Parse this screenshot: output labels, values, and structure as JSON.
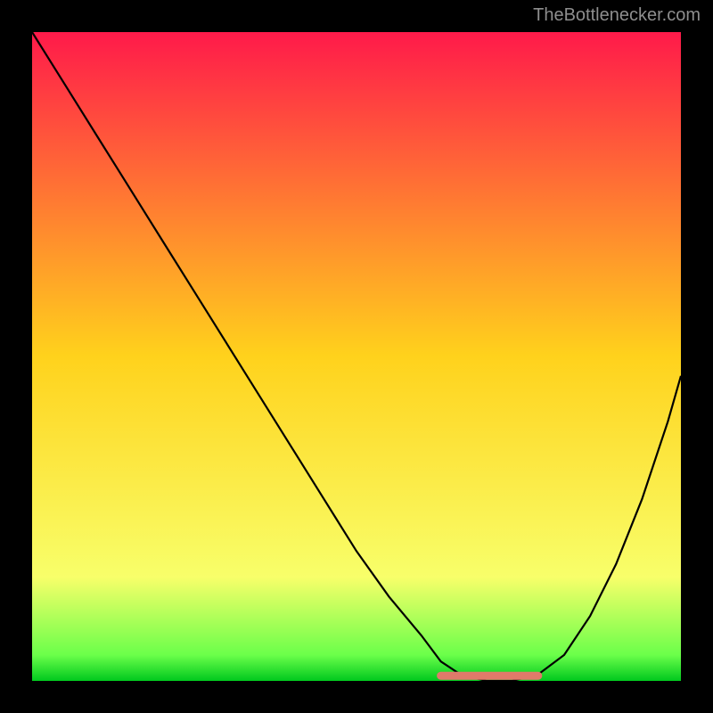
{
  "watermark": "TheBottlenecker.com",
  "chart_data": {
    "type": "line",
    "title": "",
    "xlabel": "",
    "ylabel": "",
    "xlim": [
      0,
      100
    ],
    "ylim": [
      0,
      100
    ],
    "background": "heatmap-gradient",
    "gradient_stops": [
      {
        "offset": 0,
        "color": "#ff1a4a"
      },
      {
        "offset": 50,
        "color": "#ffd21c"
      },
      {
        "offset": 84,
        "color": "#f8ff6a"
      },
      {
        "offset": 96,
        "color": "#6bff4a"
      },
      {
        "offset": 100,
        "color": "#00c81e"
      }
    ],
    "series": [
      {
        "name": "bottleneck-curve",
        "color": "#000000",
        "x": [
          0,
          5,
          10,
          15,
          20,
          25,
          30,
          35,
          40,
          45,
          50,
          55,
          60,
          63,
          66,
          70,
          74,
          78,
          82,
          86,
          90,
          94,
          98,
          100
        ],
        "y": [
          100,
          92,
          84,
          76,
          68,
          60,
          52,
          44,
          36,
          28,
          20,
          13,
          7,
          3,
          1,
          0,
          0,
          1,
          4,
          10,
          18,
          28,
          40,
          47
        ]
      },
      {
        "name": "optimum-band",
        "color": "#e07a6a",
        "type": "segment",
        "x": [
          63,
          78
        ],
        "y": [
          0.8,
          0.8
        ]
      }
    ],
    "annotations": []
  }
}
